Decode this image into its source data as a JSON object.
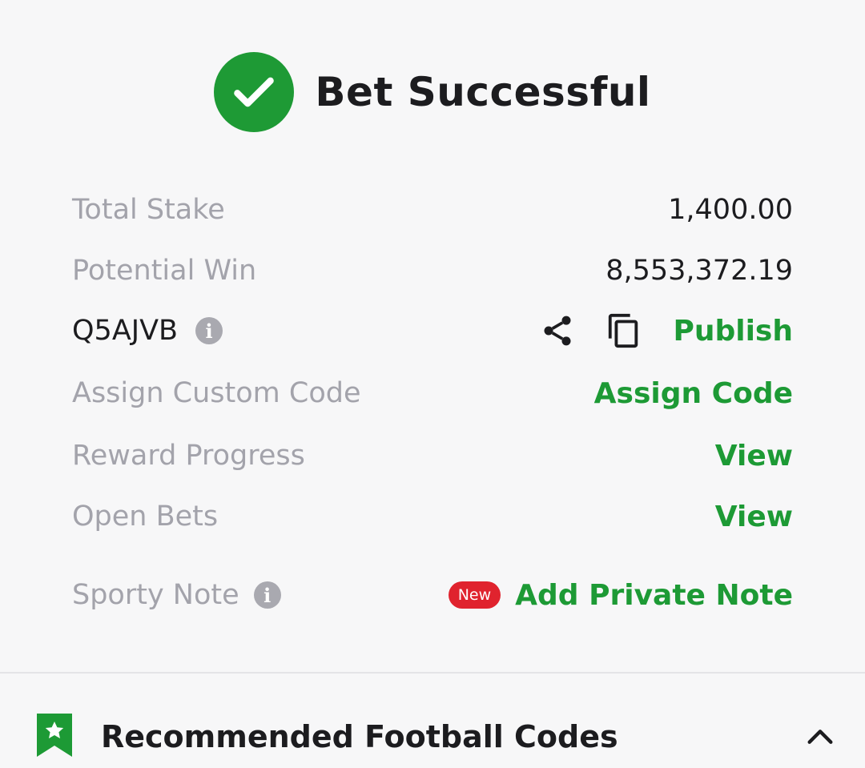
{
  "header": {
    "title": "Bet Successful",
    "icon": "check-circle-icon",
    "accent": "#1e9a35"
  },
  "rows": {
    "total_stake": {
      "label": "Total Stake",
      "value": "1,400.00"
    },
    "potential_win": {
      "label": "Potential Win",
      "value": "8,553,372.19"
    },
    "booking": {
      "code": "Q5AJVB",
      "info": "i",
      "publish": "Publish"
    },
    "custom_code": {
      "label": "Assign Custom Code",
      "action": "Assign Code"
    },
    "reward": {
      "label": "Reward Progress",
      "action": "View"
    },
    "open_bets": {
      "label": "Open Bets",
      "action": "View"
    },
    "note": {
      "label": "Sporty Note",
      "info": "i",
      "badge": "New",
      "action": "Add Private Note"
    }
  },
  "recommended": {
    "title": "Recommended Football Codes",
    "icon": "bookmark-star-icon",
    "toggle": "chevron-up-icon"
  },
  "colors": {
    "green": "#1d9a35",
    "badge_red": "#e0232e",
    "muted": "#a3a3ab"
  }
}
